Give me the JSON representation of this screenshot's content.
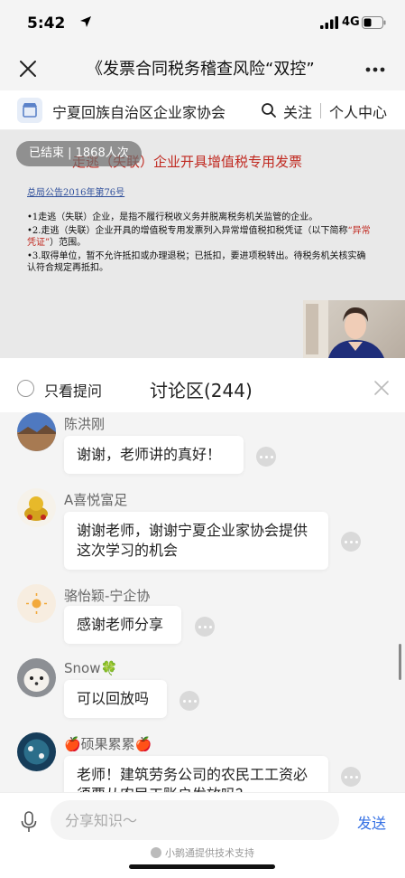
{
  "status": {
    "time": "5:42",
    "network": "4G"
  },
  "titlebar": {
    "title": "《发票合同税务稽查风险“双控”"
  },
  "org": {
    "name": "宁夏回族自治区企业家协会",
    "follow_label": "关注",
    "center_label": "个人中心"
  },
  "slide": {
    "ended_badge": "已结束 | 1868人次",
    "heading": "走逃（失联）企业开具增值税专用发票",
    "link": "总局公告2016年第76号",
    "bullet_1": "•1走逃（失联）企业，是指不履行税收义务并脱离税务机关监管的企业。",
    "bullet_2a": "•2.走逃（失联）企业开具的增值税专用发票列入异常增值税扣税凭证（以下简称",
    "bullet_2b": "“异常凭证”",
    "bullet_2c": "）范围。",
    "bullet_3": "•3.取得单位，暂不允许抵扣或办理退税；已抵扣，要进项税转出。待税务机关核实确认符合规定再抵扣。"
  },
  "discussion": {
    "only_questions_label": "只看提问",
    "title": "讨论区(244)",
    "messages": [
      {
        "name": "陈洪刚",
        "text": "谢谢，老师讲的真好！"
      },
      {
        "name": "A喜悦富足",
        "text": "谢谢老师，谢谢宁夏企业家协会提供这次学习的机会"
      },
      {
        "name": "骆怡颖-宁企协",
        "text": "感谢老师分享"
      },
      {
        "name": "Snow🍀",
        "text": "可以回放吗"
      },
      {
        "name": "🍎硕果累累🍎",
        "text": "老师！建筑劳务公司的农民工工资必须要从农民工账户发放吗？"
      }
    ]
  },
  "input": {
    "placeholder": "分享知识～",
    "send_label": "发送",
    "powered_by": "小鹅通提供技术支持"
  },
  "colors": {
    "accent_blue": "#3470e4",
    "slide_red": "#c0281f",
    "chat_bg": "#f4f4f4"
  }
}
